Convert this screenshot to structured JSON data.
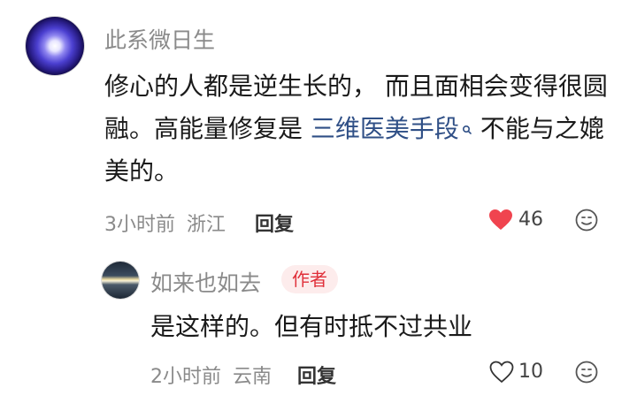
{
  "comment": {
    "username": "此系微日生",
    "text_line1": "修心的人都是逆生长的， 而且面相会变得很圆",
    "text_line2_before": "融。高能量修复是 ",
    "text_line2_link": "三维医美手段",
    "text_line2_after": " 不能与之媲",
    "text_line3": "美的。",
    "time": "3小时前",
    "location": "浙江",
    "reply_label": "回复",
    "like_count": "46",
    "liked": true
  },
  "reply": {
    "username": "如来也如去",
    "author_badge": "作者",
    "text": "是这样的。但有时抵不过共业",
    "time": "2小时前",
    "location": "云南",
    "reply_label": "回复",
    "like_count": "10",
    "liked": false
  },
  "colors": {
    "like_active": "#f0444f",
    "badge_text": "#e0303a",
    "badge_bg": "#fdecec",
    "link": "#2f4f86"
  }
}
